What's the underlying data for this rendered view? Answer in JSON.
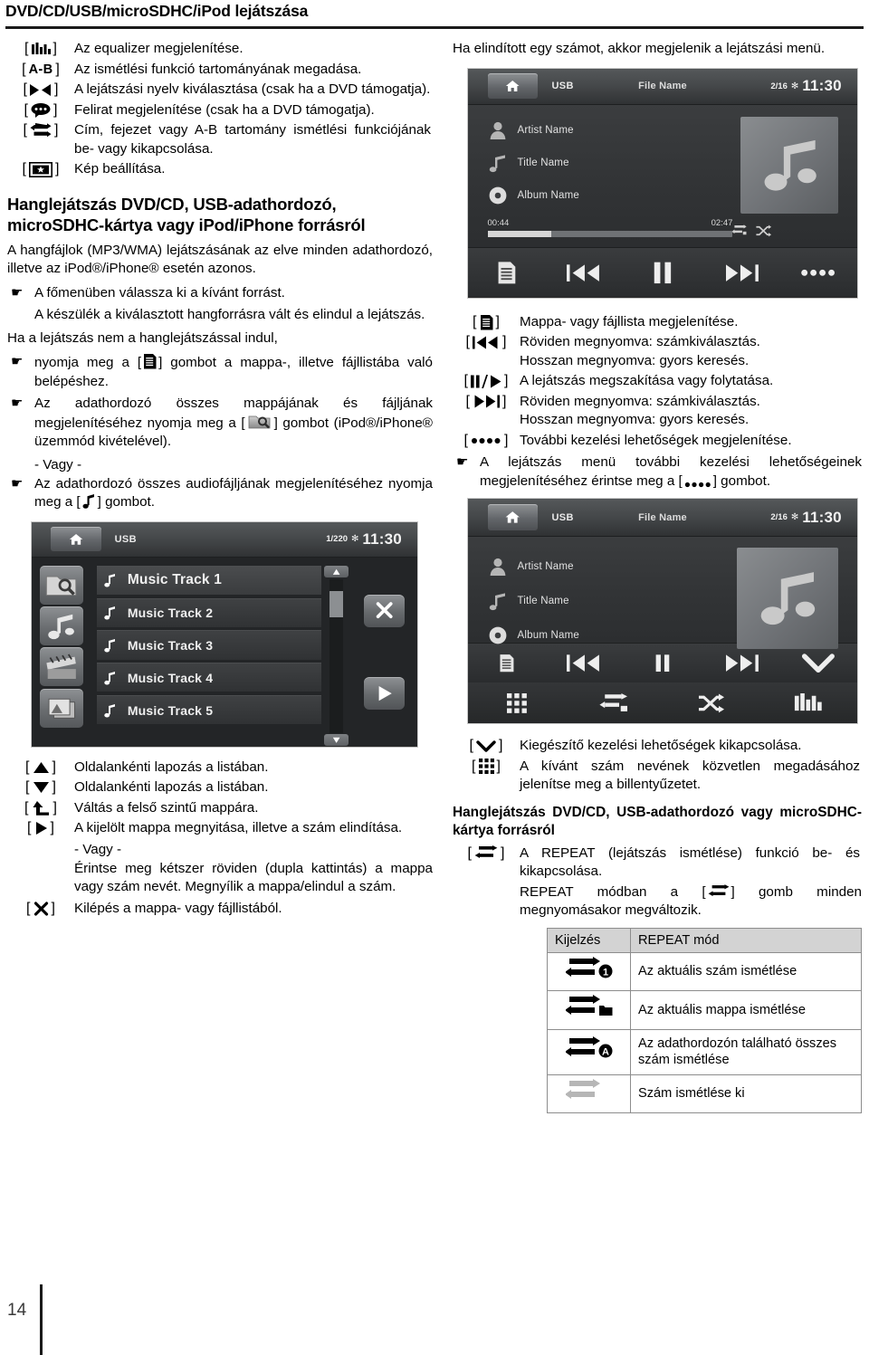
{
  "header": {
    "title": "DVD/CD/USB/microSDHC/iPod lejátszása"
  },
  "page_number": "14",
  "left_column": {
    "key_rows": [
      {
        "key_icon": "equalizer-icon",
        "key_label": "",
        "desc": "Az equalizer megjelenítése."
      },
      {
        "key_icon": "text-ab",
        "key_label": "A-B",
        "desc": "Az ismétlési funkció tartományának megadása."
      },
      {
        "key_icon": "audio-language-icon",
        "key_label": "",
        "desc": "A lejátszási nyelv kiválasztása (csak ha a DVD támogatja)."
      },
      {
        "key_icon": "subtitle-icon",
        "key_label": "",
        "desc": "Felirat megjelenítése (csak ha a DVD támogatja)."
      },
      {
        "key_icon": "repeat-icon",
        "key_label": "",
        "desc": "Cím, fejezet vagy A-B tartomány ismétlési funkciójának be- vagy kikapcsolása."
      },
      {
        "key_icon": "picture-setting-icon",
        "key_label": "",
        "desc": "Kép beállítása."
      }
    ],
    "section_title": "Hanglejátszás DVD/CD, USB-adathordozó, microSDHC-kártya vagy iPod/iPhone forrásról",
    "intro": "A hangfájlok (MP3/WMA) lejátszásának az elve minden adathordozó, illetve az iPod®/iPhone® esetén azonos.",
    "step1": "A főmenüben válassza ki a kívánt forrást.",
    "step1_note": "A készülék a kiválasztott hangforrásra vált és elindul a lejátszás.",
    "cond": "Ha a lejátszás nem a hanglejátszással indul,",
    "step2_pre": "nyomja meg a [",
    "step2_post": "] gombot a mappa-, illetve fájllistába való belépéshez.",
    "step3_pre": "Az adathordozó összes mappájának és fájljának megjelenítéséhez nyomja meg a [",
    "step3_post": "] gombot (iPod®/iPhone® üzemmód kivételével).",
    "or_label": "- Vagy -",
    "step4_pre": "Az adathordozó összes audiofájljának megjelenítéséhez nyomja meg a [",
    "step4_post": "] gombot.",
    "list_screenshot": {
      "source": "USB",
      "count": "1/220",
      "bluetooth_icon": "bluetooth-icon",
      "clock": "11:30",
      "home_icon": "home-icon",
      "side_buttons": [
        "folder-search-icon",
        "music-note-icon",
        "movie-clapper-icon",
        "photos-icon"
      ],
      "tracks": [
        "Music Track 1",
        "Music Track 2",
        "Music Track 3",
        "Music Track 4",
        "Music Track 5"
      ],
      "right_buttons": [
        "close-x-icon",
        "play-icon"
      ],
      "scroll_up_icon": "scroll-up-icon",
      "scroll_down_icon": "scroll-down-icon"
    },
    "list_key_rows": [
      {
        "key_icon": "triangle-up-icon",
        "desc": "Oldalankénti lapozás a listában."
      },
      {
        "key_icon": "triangle-down-icon",
        "desc": "Oldalankénti lapozás a listában."
      },
      {
        "key_icon": "level-up-folder-icon",
        "desc": "Váltás a felső szintű mappára."
      },
      {
        "key_icon": "play-right-icon",
        "desc": "A kijelölt mappa megnyitása, illetve a szám elindítása."
      },
      {
        "key_icon": "close-x-icon",
        "desc": "Kilépés a mappa- vagy fájllistából."
      }
    ],
    "play_or_label": "- Vagy -",
    "play_alt": "Érintse meg kétszer röviden (dupla kattintás) a mappa vagy szám nevét. Megnyílik a mappa/elindul a szám."
  },
  "right_column": {
    "intro": "Ha elindított egy számot, akkor megjelenik a lejátszási menü.",
    "player_screenshot": {
      "source": "USB",
      "center_label": "File Name",
      "count": "2/16",
      "bluetooth_icon": "bluetooth-icon",
      "clock": "11:30",
      "home_icon": "home-icon",
      "meta": [
        {
          "icon": "person-icon",
          "label": "Artist Name"
        },
        {
          "icon": "music-note-icon",
          "label": "Title Name"
        },
        {
          "icon": "disc-icon",
          "label": "Album Name"
        }
      ],
      "elapsed": "00:44",
      "total": "02:47",
      "progress_percent": 26,
      "mode_icons": [
        "repeat-folder-icon",
        "shuffle-icon"
      ],
      "transport": [
        "file-list-icon",
        "prev-track-icon",
        "pause-icon",
        "next-track-icon",
        "more-dots-icon"
      ],
      "album_art_icon": "music-note-icon"
    },
    "key_rows": [
      {
        "key_icon": "file-list-icon",
        "desc": "Mappa- vagy fájllista megjelenítése."
      },
      {
        "key_icon": "prev-track-icon",
        "desc": "Röviden megnyomva: számkiválasztás.",
        "desc2": "Hosszan megnyomva: gyors keresés."
      },
      {
        "key_icon": "pause-play-icon",
        "desc": "A lejátszás megszakítása vagy folytatása."
      },
      {
        "key_icon": "next-track-icon",
        "desc": "Röviden megnyomva: számkiválasztás.",
        "desc2": "Hosszan megnyomva: gyors keresés."
      },
      {
        "key_icon": "more-dots-icon",
        "desc": "További kezelési lehetőségek megjelenítése."
      }
    ],
    "hand_note_pre": "A lejátszás menü további kezelési lehetőségeinek megjelenítéséhez érintse meg a [",
    "hand_note_post": "] gombot.",
    "player_screenshot2": {
      "source": "USB",
      "center_label": "File Name",
      "count": "2/16",
      "bluetooth_icon": "bluetooth-icon",
      "clock": "11:30",
      "home_icon": "home-icon",
      "meta": [
        {
          "icon": "person-icon",
          "label": "Artist Name"
        },
        {
          "icon": "music-note-icon",
          "label": "Title Name"
        },
        {
          "icon": "disc-icon",
          "label": "Album Name"
        }
      ],
      "album_art_icon": "music-note-icon",
      "transport_row1": [
        "file-list-icon",
        "prev-track-icon",
        "pause-icon",
        "next-track-icon",
        "chevron-down-icon"
      ],
      "transport_row2": [
        "keypad-icon",
        "repeat-folder-icon",
        "shuffle-icon",
        "equalizer-icon"
      ]
    },
    "key_rows2": [
      {
        "key_icon": "chevron-down-icon",
        "desc": "Kiegészítő kezelési lehetőségek kikapcsolása."
      },
      {
        "key_icon": "keypad-icon",
        "desc": "A kívánt szám nevének közvetlen megadásához jelenítse meg a billentyűzetet."
      }
    ],
    "section_title2": "Hanglejátszás DVD/CD, USB-adathordozó vagy microSDHC-kártya forrásról",
    "repeat_row": {
      "key_icon": "repeat-icon",
      "desc": "A REPEAT (lejátszás ismétlése) funkció be- és kikapcsolása."
    },
    "repeat_note_pre": "REPEAT módban a [",
    "repeat_note_post": "] gomb minden megnyomásakor megváltozik.",
    "repeat_table": {
      "headers": [
        "Kijelzés",
        "REPEAT mód"
      ],
      "rows": [
        {
          "icon": "repeat-one-icon",
          "mode": "Az aktuális szám ismétlése"
        },
        {
          "icon": "repeat-folder-icon",
          "mode": "Az aktuális mappa ismétlése"
        },
        {
          "icon": "repeat-all-icon",
          "mode": "Az adathordozón található összes szám ismétlése"
        },
        {
          "icon": "repeat-off-icon",
          "mode": "Szám ismétlése ki"
        }
      ]
    }
  }
}
